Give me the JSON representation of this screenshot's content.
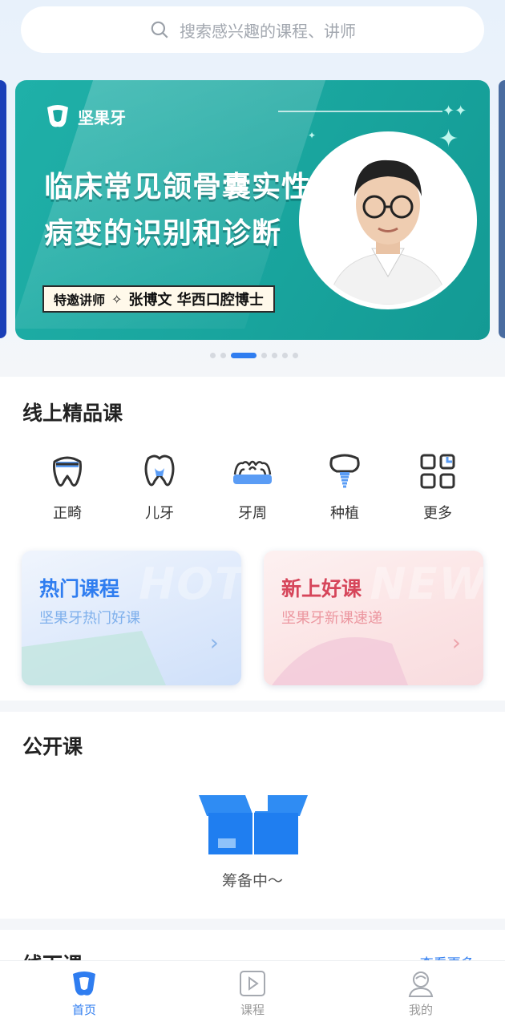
{
  "search": {
    "placeholder": "搜索感兴趣的课程、讲师"
  },
  "banner": {
    "brand": "坚果牙",
    "headline_line1": "临床常见颌骨囊实性",
    "headline_line2": "病变的识别和诊断",
    "tag_prefix": "特邀讲师",
    "tag_separator": "✧",
    "speaker": "张博文 华西口腔博士",
    "slide_count": 7,
    "active_slide": 3
  },
  "online": {
    "title": "线上精品课",
    "categories": [
      {
        "label": "正畸",
        "icon": "orthodontic-tooth-icon"
      },
      {
        "label": "儿牙",
        "icon": "child-tooth-icon"
      },
      {
        "label": "牙周",
        "icon": "periodontal-icon"
      },
      {
        "label": "种植",
        "icon": "implant-icon"
      },
      {
        "label": "更多",
        "icon": "more-grid-icon"
      }
    ],
    "promos": [
      {
        "title": "热门课程",
        "subtitle": "坚果牙热门好课",
        "bg_word": "HOT",
        "accent": "#2f7df0"
      },
      {
        "title": "新上好课",
        "subtitle": "坚果牙新课速递",
        "bg_word": "NEW",
        "accent": "#d6455a"
      }
    ]
  },
  "open_course": {
    "title": "公开课",
    "empty_text": "筹备中～"
  },
  "offline": {
    "title": "线下课",
    "more": "查看更多 ›"
  },
  "tabbar": {
    "items": [
      {
        "label": "首页",
        "active": true
      },
      {
        "label": "课程",
        "active": false
      },
      {
        "label": "我的",
        "active": false
      }
    ]
  },
  "colors": {
    "primary": "#2f7df0",
    "banner": "#1aa79f"
  }
}
